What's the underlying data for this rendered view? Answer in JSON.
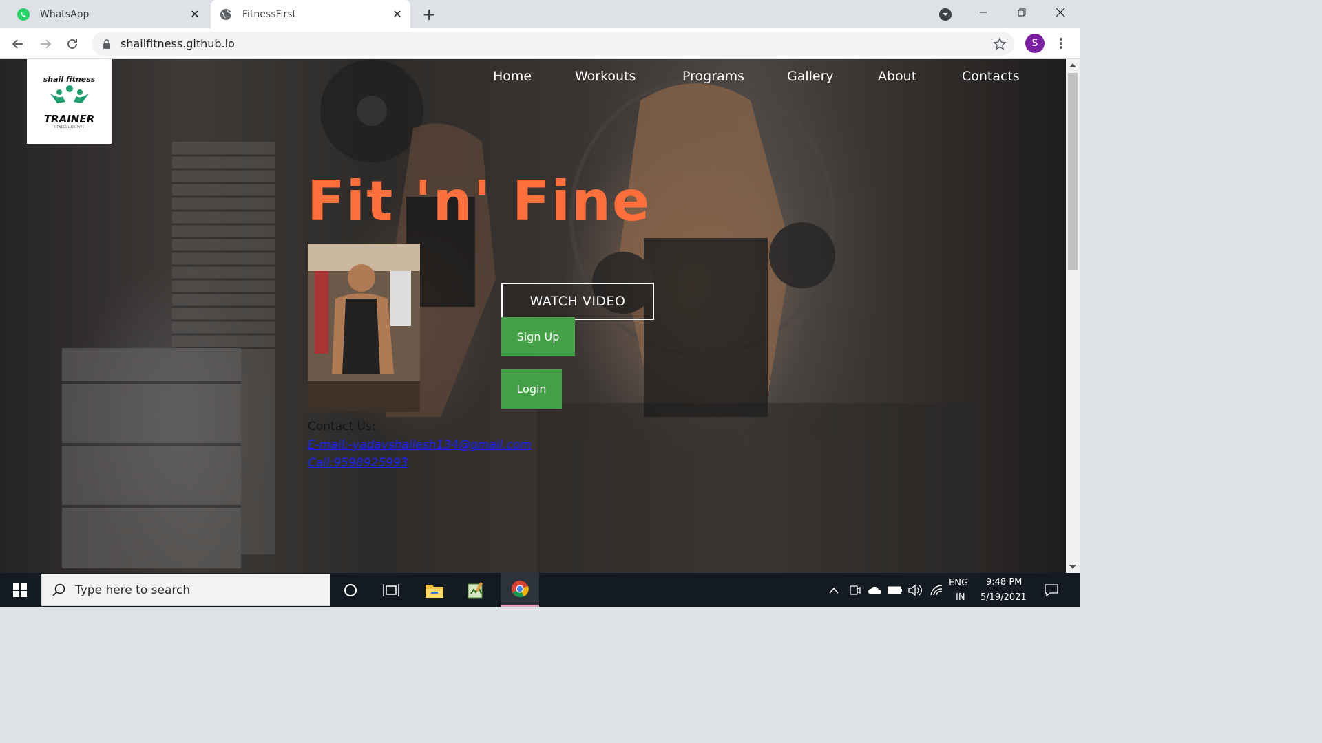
{
  "browser": {
    "tabs": [
      {
        "title": "WhatsApp",
        "favicon": "whatsapp-icon",
        "active": false
      },
      {
        "title": "FitnessFirst",
        "favicon": "globe-icon",
        "active": true
      }
    ],
    "url": "shailfitness.github.io",
    "profile_initial": "S"
  },
  "page": {
    "logo": {
      "top": "shail fitness",
      "main": "TRAINER",
      "sub": "FITNESS LOGOTYPE"
    },
    "nav": [
      "Home",
      "Workouts",
      "Programs",
      "Gallery",
      "About",
      "Contacts"
    ],
    "hero_title": "Fit 'n' Fine",
    "watch_video": "WATCH VIDEO",
    "signup": "Sign Up",
    "login": "Login",
    "contact": {
      "title": "Contact Us:",
      "email": "E-mail:-yadavshailesh134@gmail.com",
      "call": "Call:9598925993"
    },
    "colors": {
      "accent": "#ff6f3c",
      "button_green": "#43a047",
      "link": "#1a22ff"
    }
  },
  "taskbar": {
    "search_placeholder": "Type here to search",
    "lang": "ENG",
    "region": "IN",
    "time": "9:48 PM",
    "date": "5/19/2021"
  }
}
